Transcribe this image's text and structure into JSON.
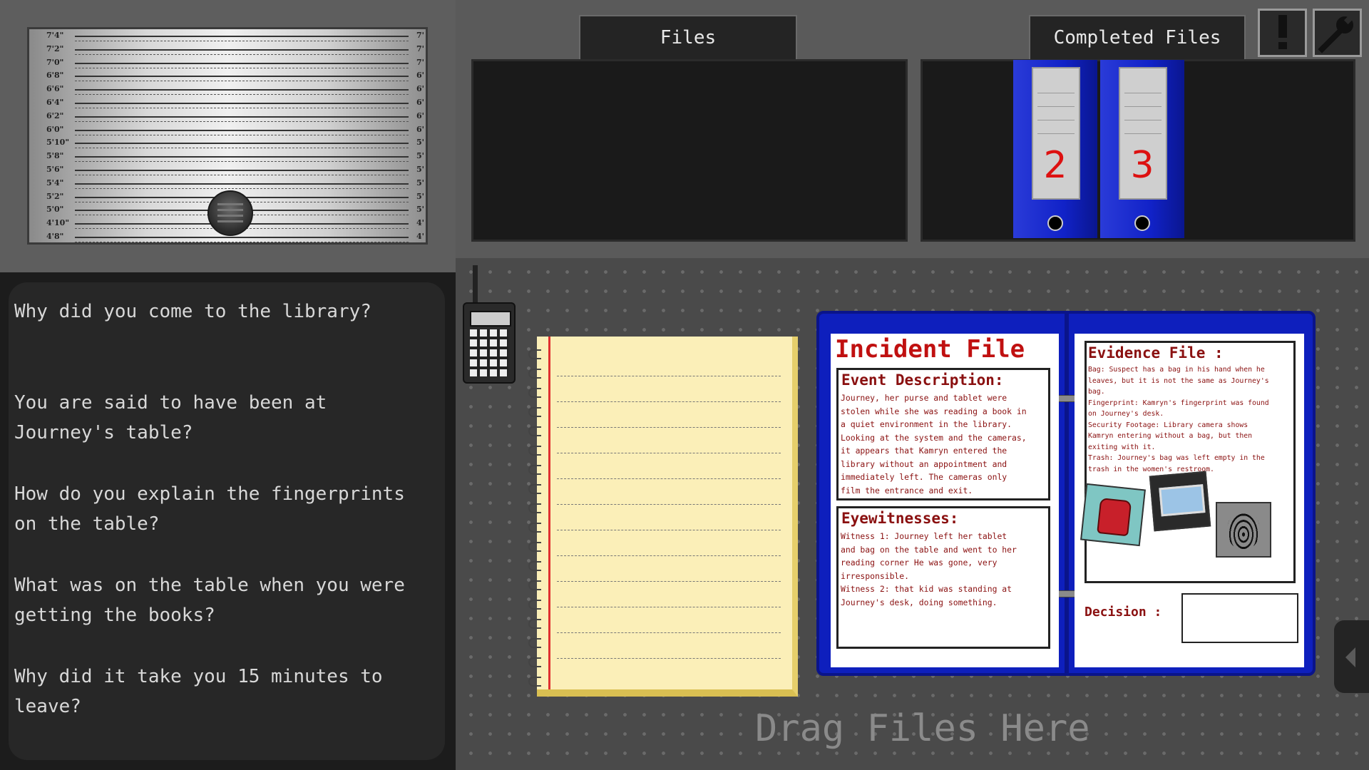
{
  "lineup": {
    "height_marks": [
      "7'4\"",
      "7'2\"",
      "7'0\"",
      "6'8\"",
      "6'6\"",
      "6'4\"",
      "6'2\"",
      "6'0\"",
      "5'10\"",
      "5'8\"",
      "5'6\"",
      "5'4\"",
      "5'2\"",
      "5'0\"",
      "4'10\"",
      "4'8\""
    ],
    "height_marks_right": [
      "7'",
      "7'",
      "7'",
      "6'",
      "6'",
      "6'",
      "6'",
      "6'",
      "5'",
      "5'",
      "5'",
      "5'",
      "5'",
      "5'",
      "4'",
      "4'"
    ]
  },
  "questions": [
    "Why did you come to the library?",
    "You are said to have been at Journey's table?",
    "How do you explain the fingerprints on the table?",
    "What was on the table when you were getting the books?",
    "Why did it take you 15 minutes to leave?"
  ],
  "tabs": {
    "files": "Files",
    "completed": "Completed Files"
  },
  "binders": [
    {
      "number": "2"
    },
    {
      "number": "3"
    }
  ],
  "incident_file": {
    "title": "Incident File",
    "event_heading": "Event Description:",
    "event_lines": [
      "Journey, her purse and tablet were",
      "stolen while she was reading a book in",
      "a quiet environment in the library.",
      "Looking at the system and the cameras,",
      "it appears that Kamryn entered the",
      "library without an appointment and",
      "immediately left. The cameras only",
      "film the entrance and exit."
    ],
    "witness_heading": "Eyewitnesses:",
    "witness_lines": [
      "Witness 1: Journey left her tablet",
      "and bag on the table and went to her",
      "reading corner He was gone, very",
      "irresponsible.",
      "Witness 2: that kid was standing at",
      "Journey's desk, doing something."
    ]
  },
  "evidence_file": {
    "heading": "Evidence File :",
    "lines": [
      "Bag: Suspect has a bag in his hand when he",
      "leaves, but it is not the same as Journey's",
      "bag.",
      "Fingerprint: Kamryn's fingerprint was found",
      "on Journey's desk.",
      "Security Footage: Library camera shows",
      "Kamryn entering without a bag, but then",
      "exiting with it.",
      "Trash: Journey's bag was left empty in the",
      "trash in the women's restroom."
    ],
    "decision_label": "Decision :"
  },
  "drag_zone_label": "Drag Files Here",
  "icons": {
    "alert": "exclamation-icon",
    "settings": "wrench-icon",
    "collapse": "chevron-left-icon"
  },
  "colors": {
    "folder_blue": "#0e1fbd",
    "evidence_red": "#8a1010",
    "binder_number_red": "#dd1111",
    "notepad_yellow": "#fbefb8"
  }
}
